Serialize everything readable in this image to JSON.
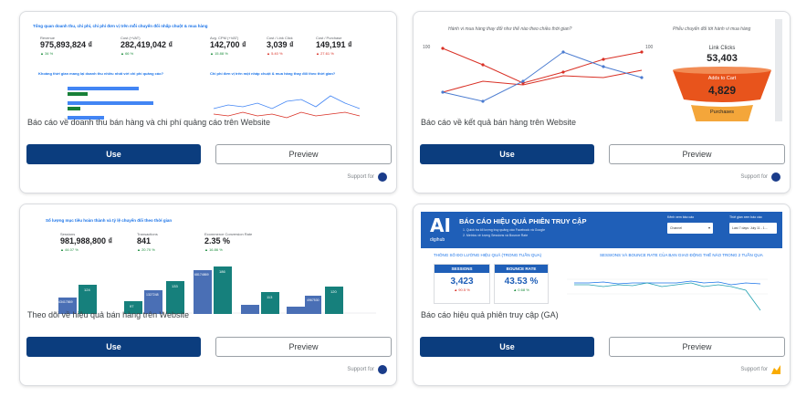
{
  "cards": [
    {
      "title": "Báo cáo về doanh thu bán hàng và chi phí quảng cáo trên Website",
      "use_label": "Use",
      "preview_label": "Preview",
      "support_label": "Support for",
      "thumb": {
        "header": "Tổng quan doanh thu, chi phí, chi phí đơn vị trên mỗi chuyển đổi nhấp chuột & mua hàng",
        "kpis": [
          {
            "label": "Revenue",
            "value": "975,893,824 ₫",
            "change": "▲ 34 %"
          },
          {
            "label": "Cost (+VAT)",
            "value": "282,419,042 ₫",
            "change": "▲ 66 %"
          },
          {
            "label": "Avg. CPM (+VAT)",
            "value": "142,700 ₫",
            "change": "▲ 15.88 %"
          },
          {
            "label": "Cost / Link Click",
            "value": "3,039 ₫",
            "change": "▲ 5.40 %"
          },
          {
            "label": "Cost / Purchase",
            "value": "149,191 ₫",
            "change": "▲ 27.61 %"
          }
        ],
        "section_left": "Khoảng thời gian mang lại doanh thu nhiều nhất với chi phí quảng cáo?",
        "section_right": "Chi phí đơn vị trên một nhấp chuột & mua hàng thay đổi theo thời gian?"
      }
    },
    {
      "title": "Báo cáo về kết quả bán hàng trên Website",
      "use_label": "Use",
      "preview_label": "Preview",
      "support_label": "Support for",
      "thumb": {
        "left_title": "Hành vi mua hàng thay đổi như thế nào theo chiều thời gian?",
        "right_title": "Phễu chuyển đổi tới hành vi mua hàng",
        "funnel": [
          {
            "label": "Link Clicks",
            "value": "53,403"
          },
          {
            "label": "Adds to Cart",
            "value": "4,829"
          },
          {
            "label": "Purchases",
            "value": ""
          }
        ],
        "y_left_top": "100",
        "y_right_top": "100"
      }
    },
    {
      "title": "Theo dõi về hiệu quả bán hàng trên Website",
      "use_label": "Use",
      "preview_label": "Preview",
      "support_label": "Support for",
      "thumb": {
        "header": "Số lượng mục tiêu hoàn thành và tỷ lệ chuyển đổi theo thời gian",
        "kpis": [
          {
            "label": "Sessions",
            "value": "981,988,800 ₫",
            "change": "▲ 44.07 %"
          },
          {
            "label": "Transactions",
            "value": "841",
            "change": "▲ 20.70 %"
          },
          {
            "label": "Ecommerce Conversion Rate",
            "value": "2.35 %",
            "change": "▲ 16.86 %"
          }
        ],
        "bar_labels": [
          "43417869",
          "124",
          "97",
          "1327248",
          "133",
          "68174869",
          "186",
          "113",
          "4967530",
          "120"
        ]
      }
    },
    {
      "title": "Báo cáo hiệu quả phiên truy cập (GA)",
      "use_label": "Use",
      "preview_label": "Preview",
      "support_label": "Support for",
      "thumb": {
        "logo": "AI",
        "logo_sub": "digihub",
        "banner_title": "BÁO CÁO HIỆU QUẢ PHIÊN TRUY CẬP",
        "banner_line1": "1. Quick tra lối lượng truy quảng cáo Facebook và Google",
        "banner_line2": "2. Metrics về lượng Sessions và Bounce Rate",
        "filter1_label": "Kênh xem báo cáo",
        "filter1_value": "Channel",
        "filter2_label": "Thời gian xem báo cáo",
        "filter2_value": "Last 7 days: July 11 - 1...",
        "left_section": "THÔNG SỐ ĐO LƯỜNG HIỆU QUẢ (TRONG TUẦN QUA)",
        "right_section": "SESSIONS VÀ BOUNCE RATE CỦA BẠN GIAO ĐỘNG THẾ NÀO TRONG 2 TUẦN QUA",
        "sessions_label": "SESSIONS",
        "sessions_value": "3,423",
        "sessions_change": "▲ 90.5 %",
        "bounce_label": "BOUNCE RATE",
        "bounce_value": "43.53 %",
        "bounce_change": "▲ 0.68 %"
      }
    }
  ]
}
